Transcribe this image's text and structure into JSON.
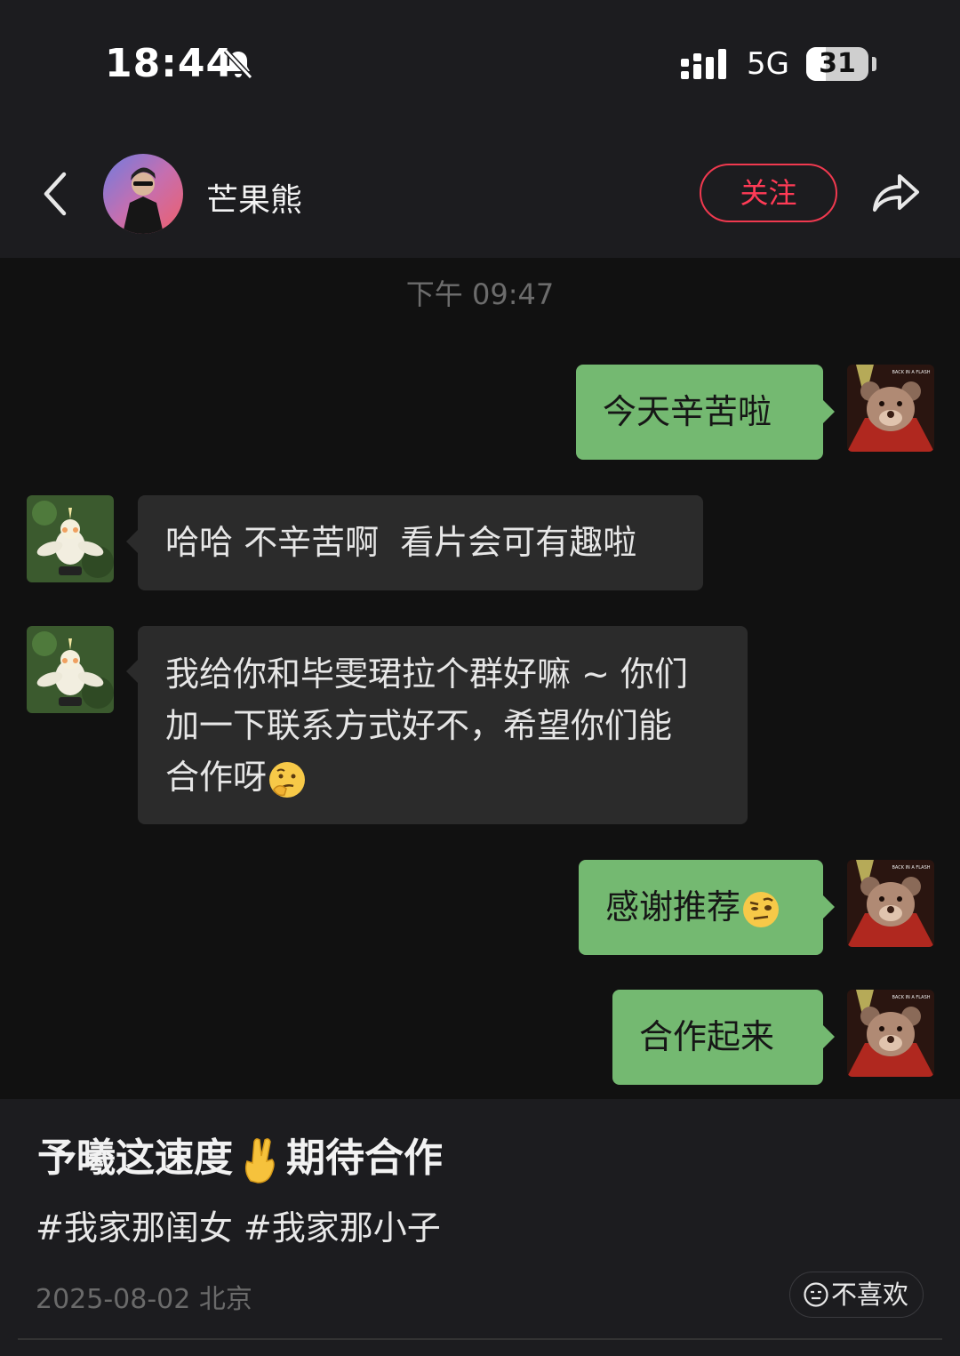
{
  "status_bar": {
    "time": "18:44",
    "network": "5G",
    "battery": "31",
    "battery_level": 0.31,
    "icons": [
      "bell-slash-icon",
      "signal-icon"
    ]
  },
  "header": {
    "name": "芒果熊",
    "follow_label": "关注",
    "icons": [
      "chevron-left-icon",
      "share-arrow-icon"
    ]
  },
  "chat": {
    "timestamp": "下午 09:47",
    "messages": [
      {
        "side": "right",
        "text": "今天辛苦啦"
      },
      {
        "side": "left",
        "text": "哈哈 不辛苦啊  看片会可有趣啦"
      },
      {
        "side": "left",
        "lines": [
          "我给你和毕雯珺拉个群好嘛 ~ 你们",
          "加一下联系方式好不，希望你们能",
          "合作呀"
        ],
        "emoji": "thinking-face-emoji"
      },
      {
        "side": "right",
        "text": "感谢推荐",
        "emoji": "raised-eyebrow-emoji"
      },
      {
        "side": "right",
        "text": "合作起来"
      }
    ]
  },
  "post": {
    "caption_a": "予曦这速度",
    "caption_b": "期待合作",
    "caption_emoji": "crossed-fingers-emoji",
    "tags": "#我家那闺女 #我家那小子",
    "meta": "2025-08-02 北京",
    "dislike_label": "不喜欢"
  },
  "colors": {
    "background": "#1c1c1f",
    "chat_background": "#111111",
    "bubble_out": "#74b971",
    "bubble_in": "#2b2b2b",
    "follow_red": "#ff3b56"
  }
}
